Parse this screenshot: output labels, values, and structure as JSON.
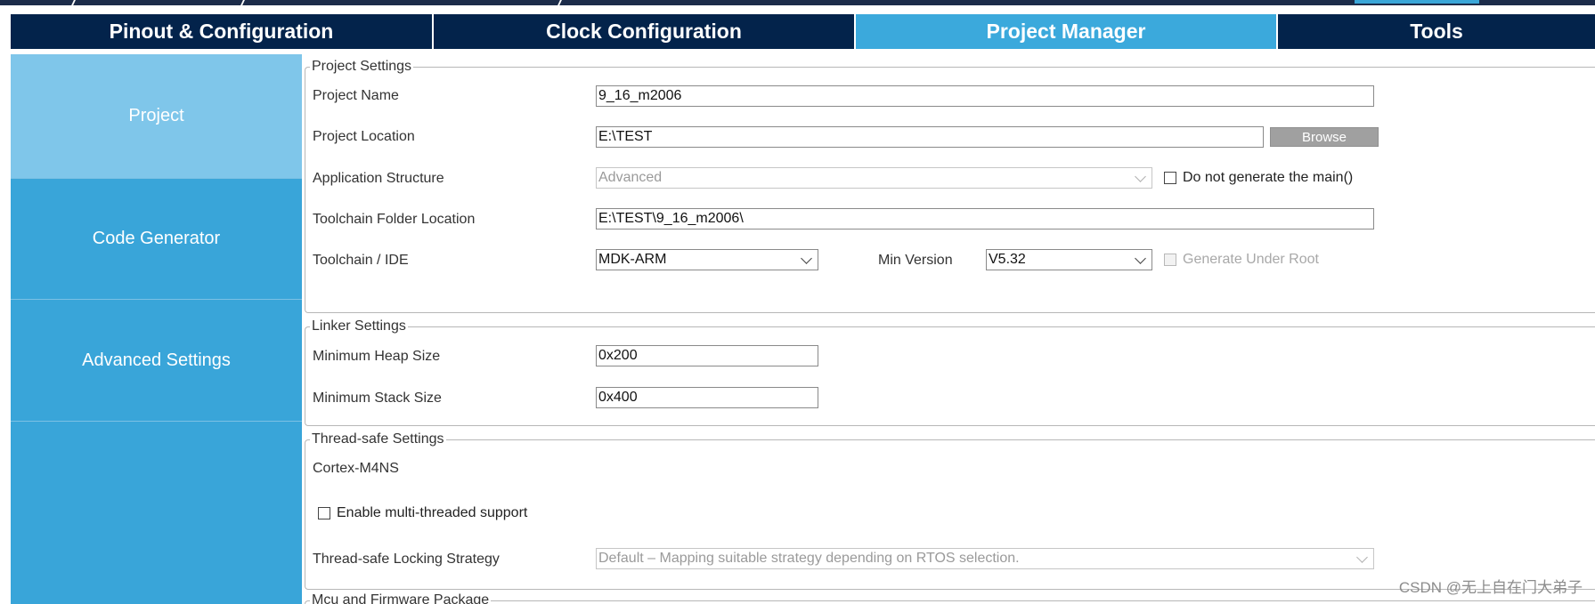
{
  "tabs": [
    {
      "label": "Pinout & Configuration",
      "active": false
    },
    {
      "label": "Clock Configuration",
      "active": false
    },
    {
      "label": "Project Manager",
      "active": true
    },
    {
      "label": "Tools",
      "active": false
    }
  ],
  "sidebar": {
    "items": [
      {
        "label": "Project",
        "active": true
      },
      {
        "label": "Code Generator",
        "active": false
      },
      {
        "label": "Advanced Settings",
        "active": false
      }
    ]
  },
  "project_settings": {
    "legend": "Project Settings",
    "project_name_label": "Project Name",
    "project_name_value": "9_16_m2006",
    "project_location_label": "Project Location",
    "project_location_value": "E:\\TEST",
    "browse_label": "Browse",
    "app_structure_label": "Application Structure",
    "app_structure_value": "Advanced",
    "no_main_label": "Do not generate the main()",
    "toolchain_folder_label": "Toolchain Folder Location",
    "toolchain_folder_value": "E:\\TEST\\9_16_m2006\\",
    "toolchain_ide_label": "Toolchain / IDE",
    "toolchain_ide_value": "MDK-ARM",
    "min_version_label": "Min Version",
    "min_version_value": "V5.32",
    "generate_under_root_label": "Generate Under Root"
  },
  "linker_settings": {
    "legend": "Linker Settings",
    "heap_label": "Minimum Heap Size",
    "heap_value": "0x200",
    "stack_label": "Minimum Stack Size",
    "stack_value": "0x400"
  },
  "thread_safe_settings": {
    "legend": "Thread-safe Settings",
    "core_label": "Cortex-M4NS",
    "multithread_label": "Enable multi-threaded support",
    "locking_label": "Thread-safe Locking Strategy",
    "locking_value": "Default  –  Mapping suitable strategy depending on RTOS selection."
  },
  "mcu_firmware": {
    "legend": "Mcu and Firmware Package"
  },
  "watermark": "CSDN @无上自在门大弟子",
  "colors": {
    "tabbar_bg": "#03234b",
    "active_tab": "#3ba9dc",
    "sidebar_bg": "#39a5d9",
    "sidebar_active": "#7fc6ea",
    "button_gray": "#a0a0a0"
  }
}
